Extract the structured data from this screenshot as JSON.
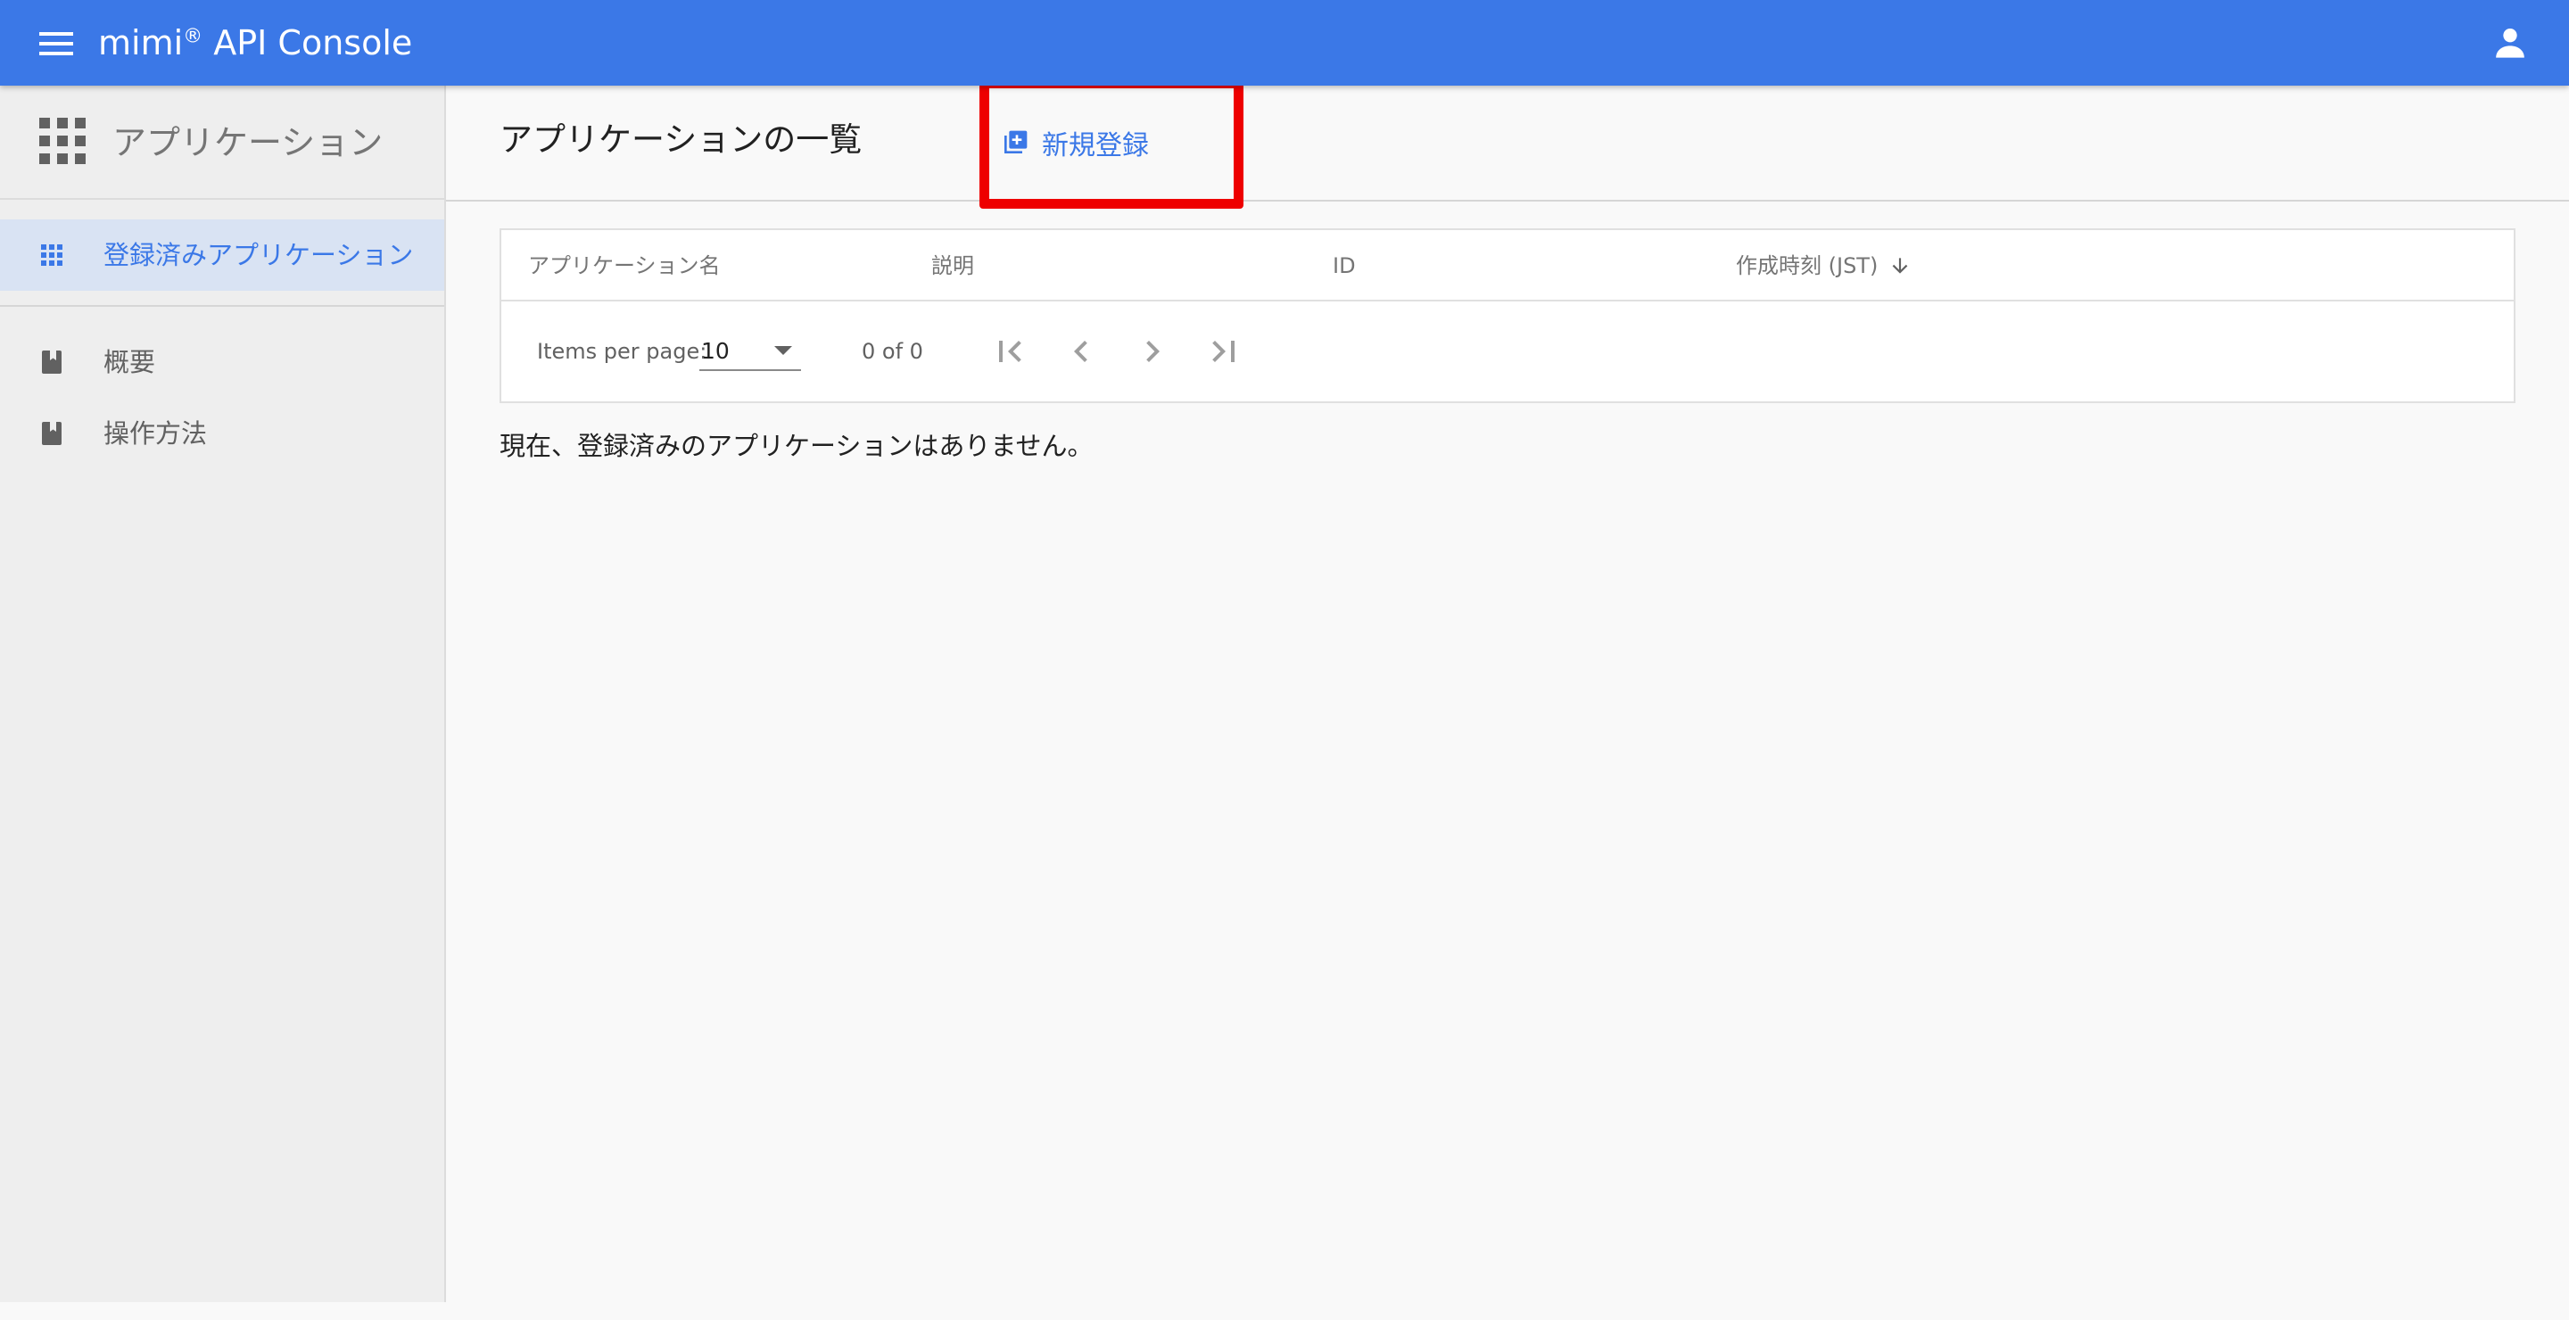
{
  "topbar": {
    "title": "mimi",
    "title_mark": "®",
    "title_suffix": " API Console",
    "menu_icon": "hamburger-menu-icon",
    "account_icon": "person-icon",
    "color": "#3b78e7"
  },
  "sidebar": {
    "title": "アプリケーション",
    "title_icon": "apps-grid-icon",
    "items": [
      {
        "label": "登録済みアプリケーション",
        "icon": "apps-icon",
        "active": true
      },
      {
        "label": "概要",
        "icon": "book-icon",
        "active": false
      },
      {
        "label": "操作方法",
        "icon": "book-icon",
        "active": false
      }
    ]
  },
  "main": {
    "title": "アプリケーションの一覧",
    "new_button_label": "新規登録",
    "new_button_icon": "library-add-icon",
    "highlight_color": "#ee0000",
    "table": {
      "columns": [
        "アプリケーション名",
        "説明",
        "ID",
        "作成時刻 (JST)"
      ],
      "sort_icon": "arrow-downward-icon",
      "rows": []
    },
    "paginator": {
      "items_per_page_label": "Items per page:",
      "page_size": "10",
      "range_label": "0 of 0",
      "buttons": [
        "first-page-icon",
        "previous-page-icon",
        "next-page-icon",
        "last-page-icon"
      ]
    },
    "empty_message": "現在、登録済みのアプリケーションはありません。"
  }
}
